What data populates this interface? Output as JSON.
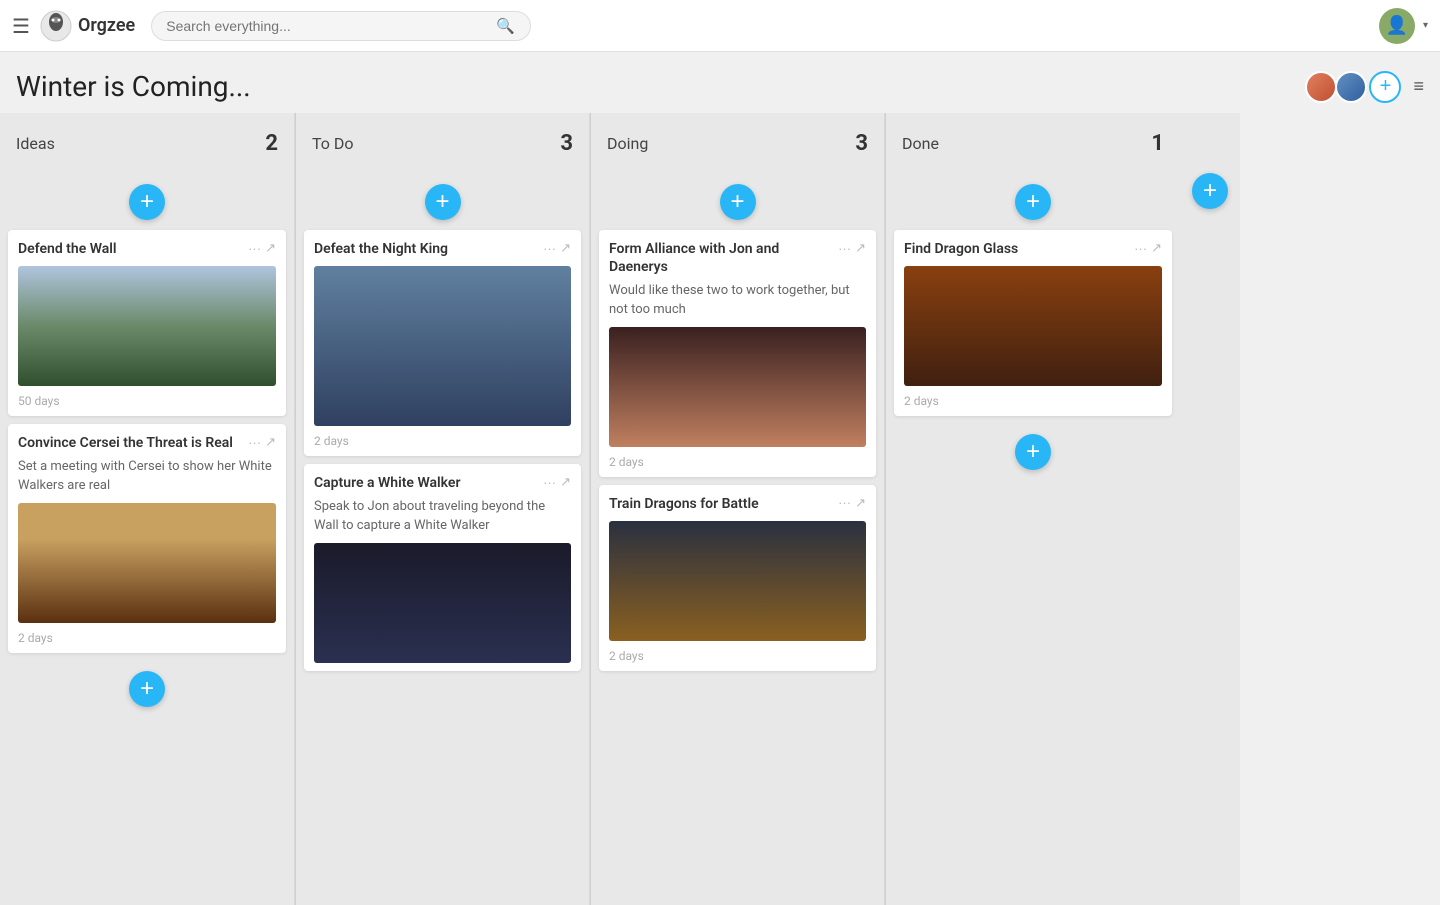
{
  "header": {
    "hamburger": "☰",
    "logo_text": "Orgzee",
    "search_placeholder": "Search everything...",
    "search_icon": "🔍"
  },
  "page": {
    "title": "Winter is Coming...",
    "add_member_label": "+",
    "board_menu": "≡"
  },
  "columns": [
    {
      "id": "ideas",
      "title": "Ideas",
      "count": "2",
      "cards": [
        {
          "id": "defend-wall",
          "title": "Defend the Wall",
          "description": "",
          "has_image": true,
          "image_class": "img-wall",
          "days": "50 days"
        },
        {
          "id": "convince-cersei",
          "title": "Convince Cersei the Threat is Real",
          "description": "Set a meeting with Cersei to show her White Walkers are real",
          "has_image": true,
          "image_class": "img-cersei",
          "days": "2 days"
        }
      ]
    },
    {
      "id": "todo",
      "title": "To Do",
      "count": "3",
      "cards": [
        {
          "id": "defeat-nightking",
          "title": "Defeat the Night King",
          "description": "",
          "has_image": true,
          "image_class": "img-nightking",
          "days": "2 days"
        },
        {
          "id": "capture-whitewalker",
          "title": "Capture a White Walker",
          "description": "Speak to Jon about traveling beyond the Wall to capture a White Walker",
          "has_image": true,
          "image_class": "img-whitewalker",
          "days": ""
        }
      ]
    },
    {
      "id": "doing",
      "title": "Doing",
      "count": "3",
      "cards": [
        {
          "id": "form-alliance",
          "title": "Form Alliance with Jon and Daenerys",
          "description": "Would like these two to work together, but not too much",
          "has_image": true,
          "image_class": "img-alliance",
          "days": "2 days"
        },
        {
          "id": "train-dragons",
          "title": "Train Dragons for Battle",
          "description": "",
          "has_image": true,
          "image_class": "img-dragon",
          "days": "2 days"
        }
      ]
    },
    {
      "id": "done",
      "title": "Done",
      "count": "1",
      "cards": [
        {
          "id": "find-dragonglass",
          "title": "Find Dragon Glass",
          "description": "",
          "has_image": true,
          "image_class": "img-dragonglass",
          "days": "2 days"
        }
      ]
    }
  ],
  "labels": {
    "add_card": "+",
    "ellipsis": "···",
    "external_link": "↗"
  }
}
